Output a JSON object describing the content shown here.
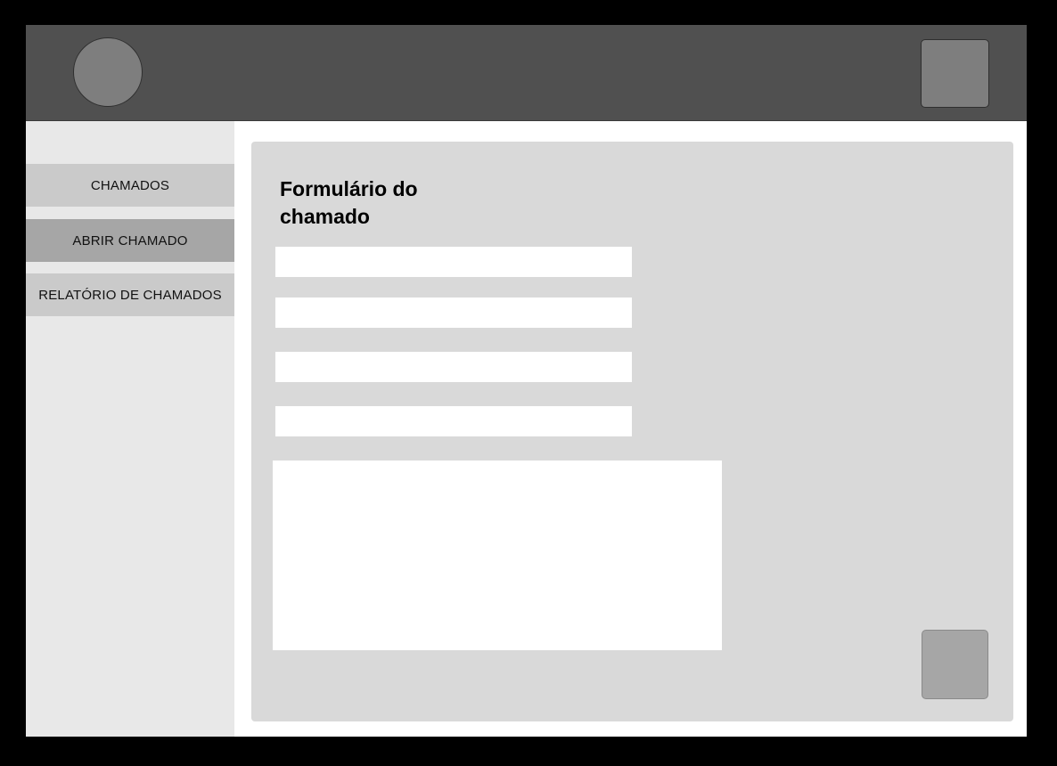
{
  "header": {
    "avatar_icon": "user-avatar-circle",
    "action_icon": "placeholder-square"
  },
  "sidebar": {
    "items": [
      {
        "label": "CHAMADOS",
        "active": false
      },
      {
        "label": "ABRIR CHAMADO",
        "active": true
      },
      {
        "label": "RELATÓRIO DE CHAMADOS",
        "active": false
      }
    ]
  },
  "form": {
    "title_line1": "Formulário do",
    "title_line2": "chamado",
    "fields": [
      {
        "value": "",
        "placeholder": ""
      },
      {
        "value": "",
        "placeholder": ""
      },
      {
        "value": "",
        "placeholder": ""
      },
      {
        "value": "",
        "placeholder": ""
      }
    ],
    "description": {
      "value": "",
      "placeholder": ""
    },
    "submit_icon": "placeholder-square"
  },
  "colors": {
    "page_background": "#000000",
    "header_background": "#505050",
    "sidebar_background": "#e8e8e8",
    "nav_item": "#cacaca",
    "nav_item_active": "#a6a6a6",
    "panel_background": "#d9d9d9",
    "field_background": "#ffffff"
  }
}
